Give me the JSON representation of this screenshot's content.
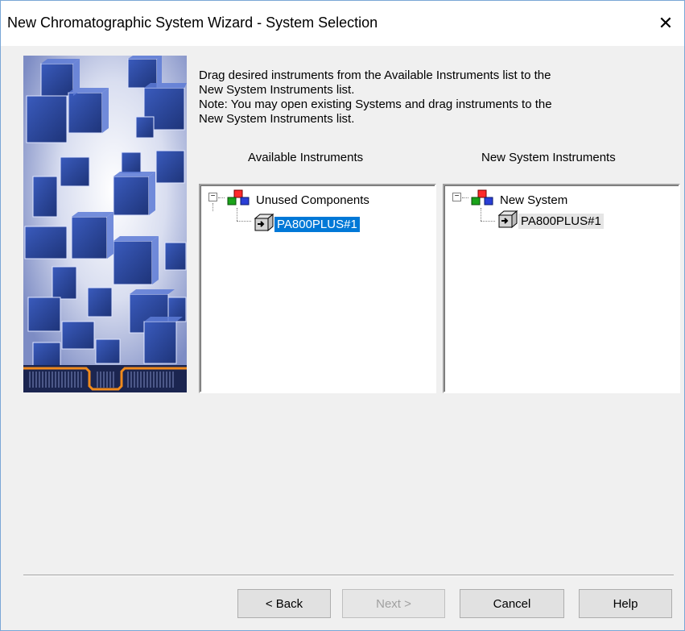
{
  "window": {
    "title": "New Chromatographic System Wizard - System Selection",
    "close_glyph": "✕"
  },
  "instructions": {
    "line1": "Drag desired instruments from the Available Instruments list to the",
    "line2": "New System Instruments list.",
    "line3": "Note:  You may open existing Systems and drag instruments to the",
    "line4": "New System Instruments list."
  },
  "available": {
    "header": "Available Instruments",
    "root_label": "Unused Components",
    "root_expander": "−",
    "child_label": "PA800PLUS#1"
  },
  "new_system": {
    "header": "New System Instruments",
    "root_label": "New System",
    "root_expander": "−",
    "child_label": "PA800PLUS#1"
  },
  "buttons": {
    "back": "< Back",
    "next": "Next >",
    "cancel": "Cancel",
    "help": "Help"
  },
  "colors": {
    "selection": "#0078d7",
    "cube_blue": "#2f4fa8",
    "accent_orange": "#f08a1c"
  },
  "icons": {
    "system_icon": "system-icon",
    "instrument_icon": "instrument-icon",
    "close_icon": "close-icon"
  }
}
